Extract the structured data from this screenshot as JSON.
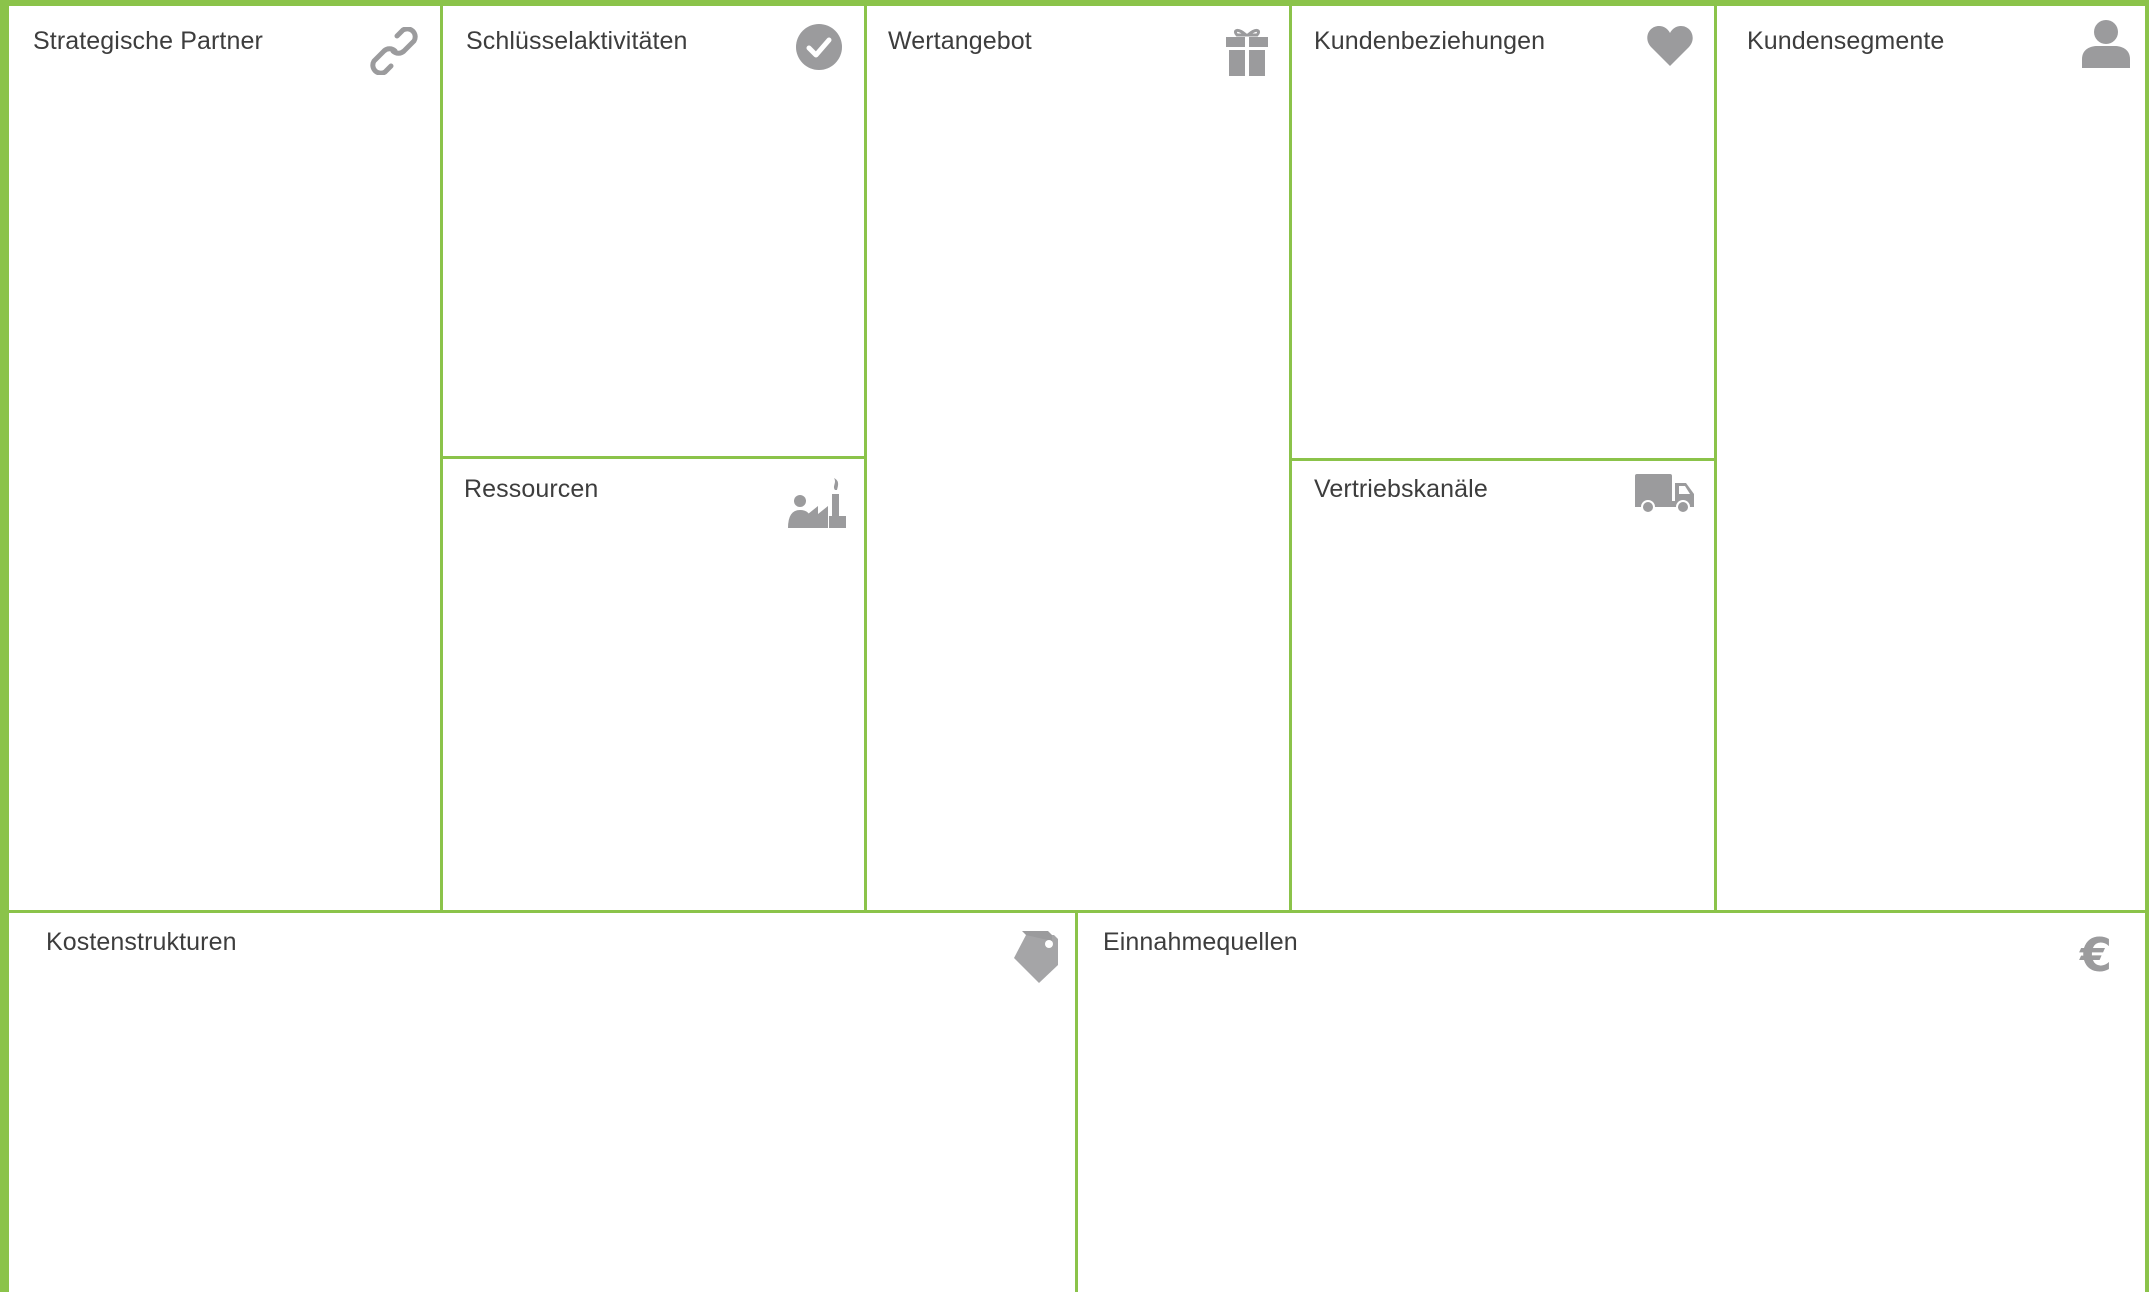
{
  "canvas": {
    "title": "",
    "accent_color": "#8bc34a",
    "icon_color": "#9b9b9d",
    "text_color": "#3d3d3d"
  },
  "blocks": {
    "key_partners": {
      "label": "Strategische Partner",
      "icon": "link-icon"
    },
    "key_activities": {
      "label": "Schlüsselaktivitäten",
      "icon": "check-circle-icon"
    },
    "key_resources": {
      "label": "Ressourcen",
      "icon": "factory-worker-icon"
    },
    "value_proposition": {
      "label": "Wertangebot",
      "icon": "gift-icon"
    },
    "customer_relationships": {
      "label": "Kundenbeziehungen",
      "icon": "heart-icon"
    },
    "channels": {
      "label": "Vertriebskanäle",
      "icon": "truck-icon"
    },
    "customer_segments": {
      "label": "Kundensegmente",
      "icon": "person-icon"
    },
    "cost_structure": {
      "label": "Kostenstrukturen",
      "icon": "price-tag-icon"
    },
    "revenue_streams": {
      "label": "Einnahmequellen",
      "icon": "euro-icon",
      "symbol": "€"
    }
  }
}
